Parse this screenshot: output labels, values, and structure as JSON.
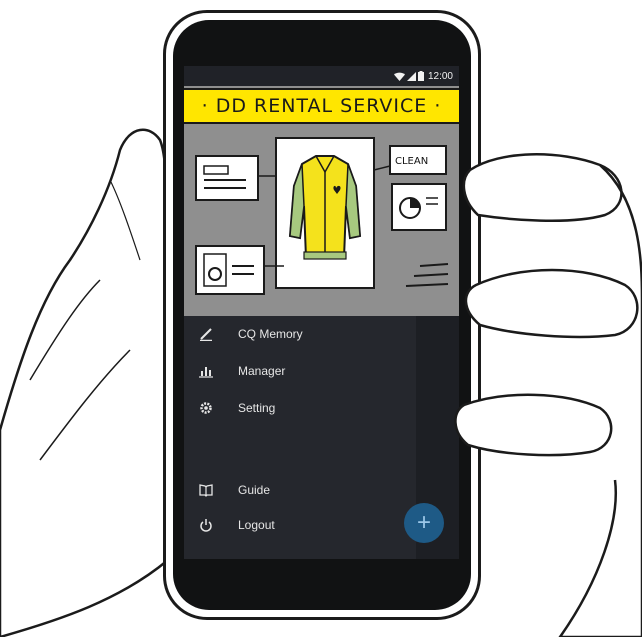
{
  "status_bar": {
    "time": "12:00"
  },
  "banner": {
    "text": "· DD RENTAL SERVICE ·"
  },
  "header_art": {
    "clean_label": "CLEAN"
  },
  "menu": {
    "items": [
      {
        "label": "CQ Memory",
        "icon": "pencil-icon"
      },
      {
        "label": "Manager",
        "icon": "bar-chart-icon"
      },
      {
        "label": "Setting",
        "icon": "gear-icon"
      },
      {
        "label": "Guide",
        "icon": "book-icon"
      },
      {
        "label": "Logout",
        "icon": "power-icon"
      }
    ]
  },
  "fab": {
    "symbol": "+"
  },
  "colors": {
    "banner": "#ffe600",
    "jacket": "#f4e21c",
    "sleeves": "#a7c97f",
    "drawer": "#25272d",
    "fab": "#1e5a86"
  }
}
